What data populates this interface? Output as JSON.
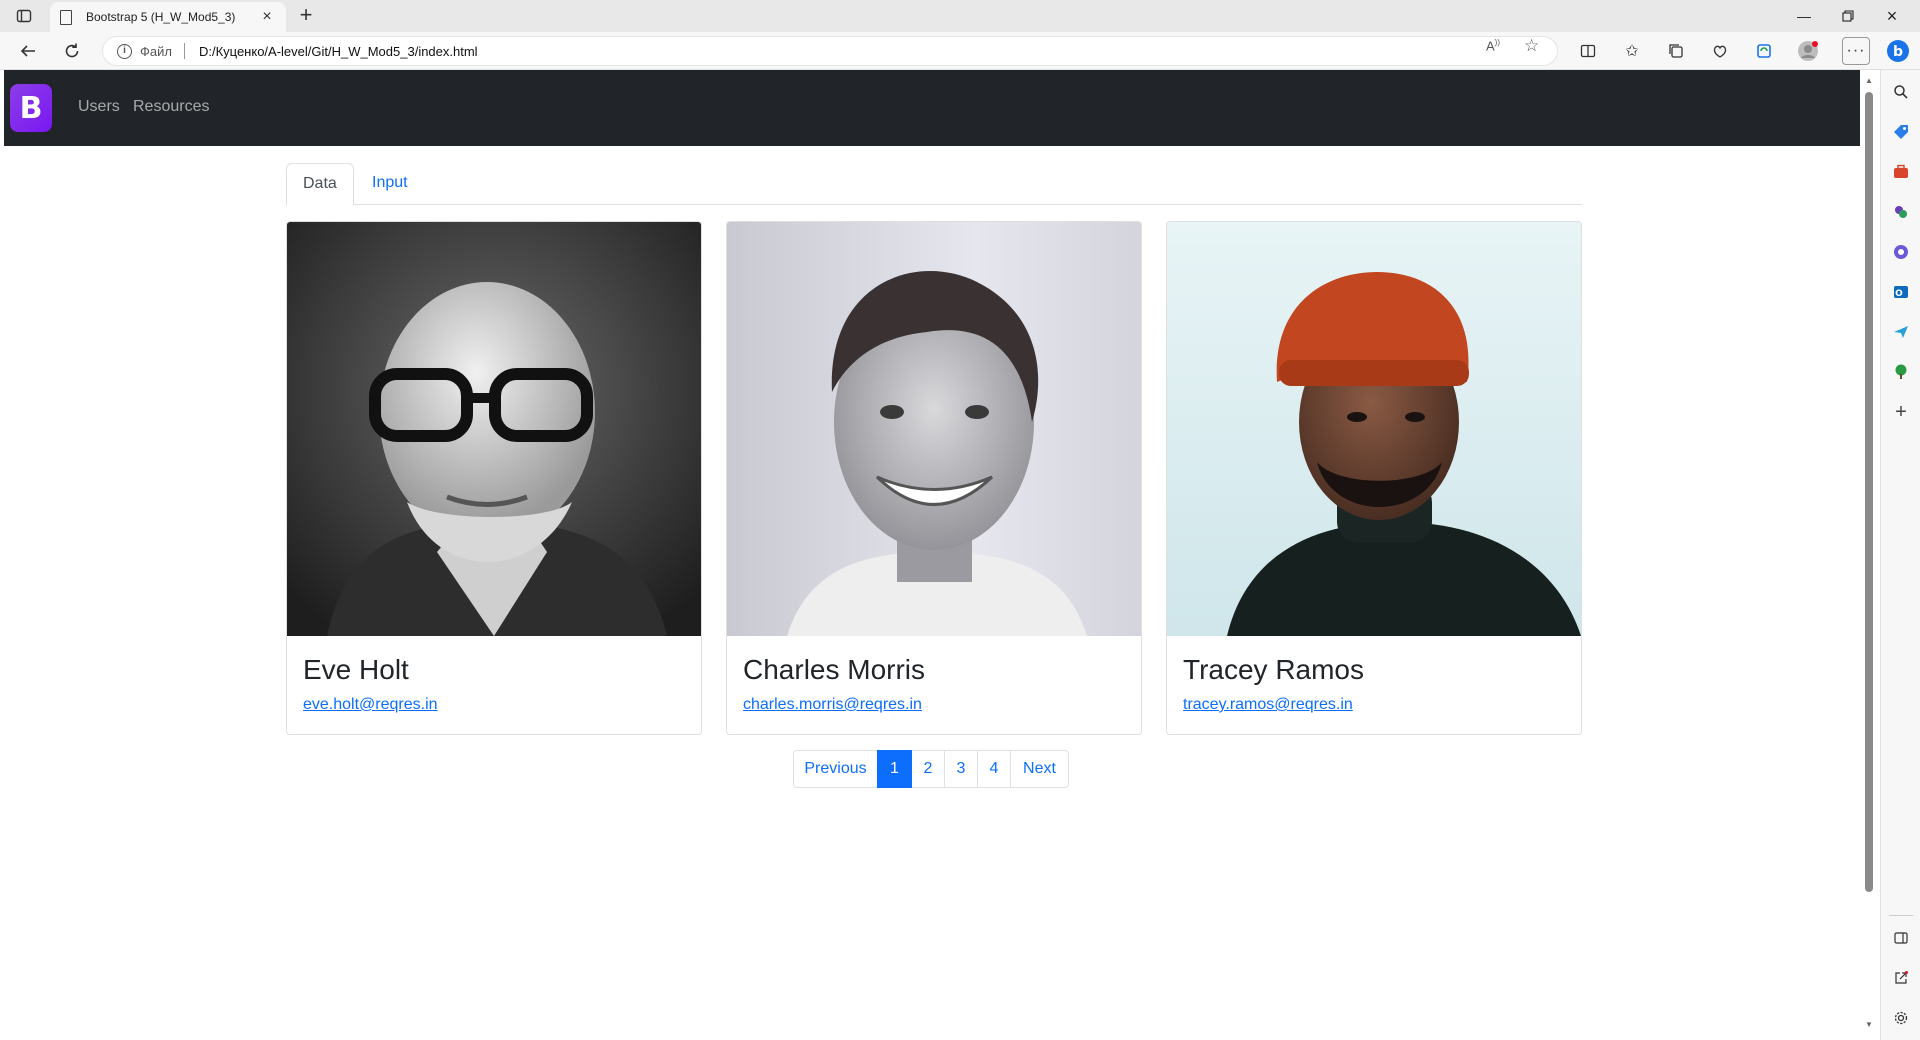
{
  "browser": {
    "tab_title": "Bootstrap 5 (H_W_Mod5_3)",
    "address_scheme": "Файл",
    "address_url": "D:/Куценко/A-level/Git/H_W_Mod5_3/index.html"
  },
  "navbar": {
    "brand": "B",
    "links": [
      "Users",
      "Resources"
    ]
  },
  "tabs": [
    {
      "label": "Data",
      "active": true
    },
    {
      "label": "Input",
      "active": false
    }
  ],
  "users": [
    {
      "name": "Eve Holt",
      "email": "eve.holt@reqres.in"
    },
    {
      "name": "Charles Morris",
      "email": "charles.morris@reqres.in"
    },
    {
      "name": "Tracey Ramos",
      "email": "tracey.ramos@reqres.in"
    }
  ],
  "pagination": {
    "previous": "Previous",
    "pages": [
      "1",
      "2",
      "3",
      "4"
    ],
    "active_page": "1",
    "next": "Next"
  },
  "colors": {
    "navbar": "#212529",
    "brand": "#7a17f2",
    "link": "#0d6efd"
  }
}
